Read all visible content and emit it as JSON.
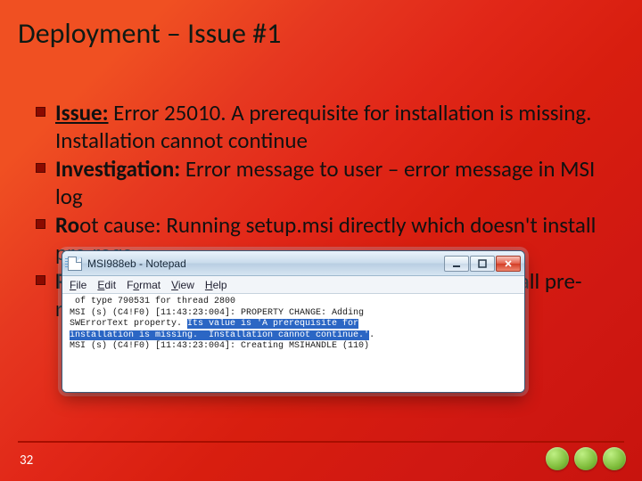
{
  "title": "Deployment – Issue #1",
  "bullets": [
    {
      "label": "Issue:",
      "underline": true,
      "text": " Error 25010. A prerequisite for installation is missing. Installation cannot continue"
    },
    {
      "label": "Investigation:",
      "underline": false,
      "text": " Error message to user – error message in MSI log"
    },
    {
      "label": "Ro",
      "underline": false,
      "text": "ot cause: Running setup.msi directly which doesn't install pre-reqs"
    },
    {
      "label": "Re",
      "underline": false,
      "text": "solution: Run Setup.exe instead, or manually install pre-reqs prior to running setup.msi"
    }
  ],
  "page_number": "32",
  "notepad": {
    "title": "MSI988eb - Notepad",
    "menu": [
      "File",
      "Edit",
      "Format",
      "View",
      "Help"
    ],
    "lines": {
      "l1": " of type 790531 for thread 2800",
      "l2": "MSI (s) (C4!F0) [11:43:23:004]: PROPERTY CHANGE: Adding",
      "l3a": "SWErrorText property. ",
      "l3sel": "Its value is 'A prerequisite for",
      "l4sel": "installation is missing.  Installation cannot continue.'",
      "l4b": ".",
      "l5": "MSI (s) (C4!F0) [11:43:23:004]: Creating MSIHANDLE (110) "
    }
  }
}
